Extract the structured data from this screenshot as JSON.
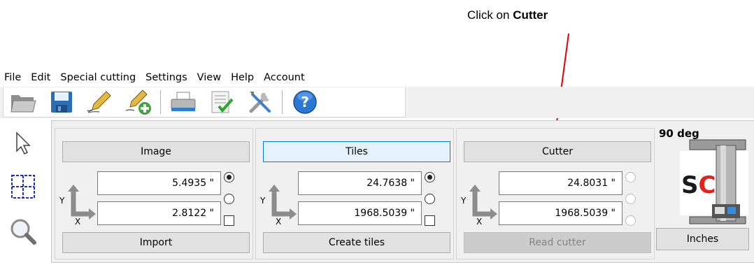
{
  "annotation": {
    "prefix": "Click on ",
    "bold": "Cutter"
  },
  "menu": [
    "File",
    "Edit",
    "Special cutting",
    "Settings",
    "View",
    "Help",
    "Account"
  ],
  "toolbar": {
    "icons": [
      "open-folder-icon",
      "save-disk-icon",
      "pen-icon",
      "pen-add-icon",
      "printer-icon",
      "checklist-icon",
      "tools-icon",
      "help-icon"
    ]
  },
  "sidebar": {
    "icons": [
      "pointer-arrow-icon",
      "grid-tiles-icon",
      "magnifier-icon"
    ]
  },
  "groups": {
    "image": {
      "header": "Image",
      "value1": "5.4935 \"",
      "value2": "2.8122 \"",
      "footer": "Import"
    },
    "tiles": {
      "header": "Tiles",
      "value1": "24.7638 \"",
      "value2": "1968.5039 \"",
      "footer": "Create tiles"
    },
    "cutter": {
      "header": "Cutter",
      "value1": "24.8031 \"",
      "value2": "1968.5039 \"",
      "footer": "Read cutter"
    }
  },
  "axis": {
    "y": "Y",
    "x": "X"
  },
  "rotation_label": "90 deg",
  "logo_text": "SC",
  "units_button": "Inches",
  "colors": {
    "arrow": "#e00000",
    "active_border": "#0078d7",
    "logo_red": "#e2231a"
  }
}
